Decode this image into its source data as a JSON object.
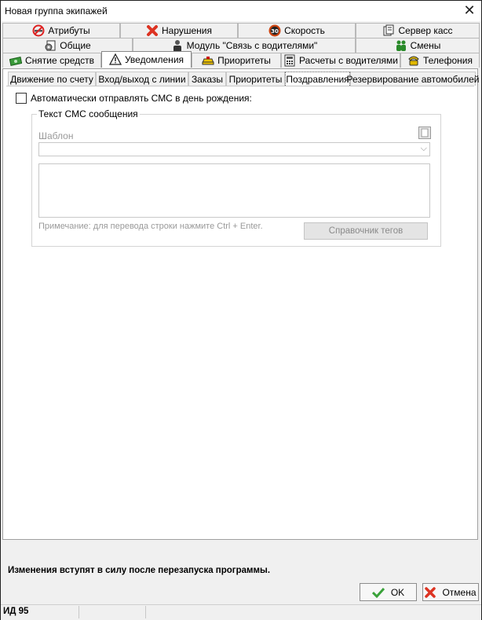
{
  "window": {
    "title": "Новая группа экипажей"
  },
  "tab_rows": [
    [
      {
        "label": "Атрибуты",
        "icon": "no-smoking-icon"
      },
      {
        "label": "Нарушения",
        "icon": "red-x-icon"
      },
      {
        "label": "Скорость",
        "icon": "speed-30-icon"
      },
      {
        "label": "Сервер касс",
        "icon": "cash-server-icon"
      }
    ],
    [
      {
        "label": "Общие",
        "icon": "settings-page-icon"
      },
      {
        "label": "Модуль \"Связь с водителями\"",
        "icon": "driver-icon"
      },
      {
        "label": "Смены",
        "icon": "people-icon"
      }
    ],
    [
      {
        "label": "Снятие средств",
        "icon": "money-icon"
      },
      {
        "label": "Уведомления",
        "icon": "warning-icon",
        "active": true
      },
      {
        "label": "Приоритеты",
        "icon": "taxi-icon"
      },
      {
        "label": "Расчеты с водителями",
        "icon": "calculator-icon"
      },
      {
        "label": "Телефония",
        "icon": "phone-icon"
      }
    ]
  ],
  "subtabs": [
    {
      "label": "Движение по счету"
    },
    {
      "label": "Вход/выход с линии"
    },
    {
      "label": "Заказы"
    },
    {
      "label": "Приоритеты"
    },
    {
      "label": "Поздравления",
      "active": true
    },
    {
      "label": "Резервирование автомобилей"
    }
  ],
  "birthday": {
    "checkbox_label": "Автоматически отправлять СМС в день рождения:",
    "checked": false,
    "group_title": "Текст СМС сообщения",
    "template_label": "Шаблон",
    "template_value": "",
    "message_text": "",
    "note": "Примечание: для перевода строки нажмите Ctrl + Enter.",
    "tags_button": "Справочник тегов"
  },
  "status_text": "Изменения вступят в силу после перезапуска программы.",
  "buttons": {
    "ok": "OK",
    "cancel": "Отмена"
  },
  "footer": {
    "id_label": "ИД 95"
  }
}
